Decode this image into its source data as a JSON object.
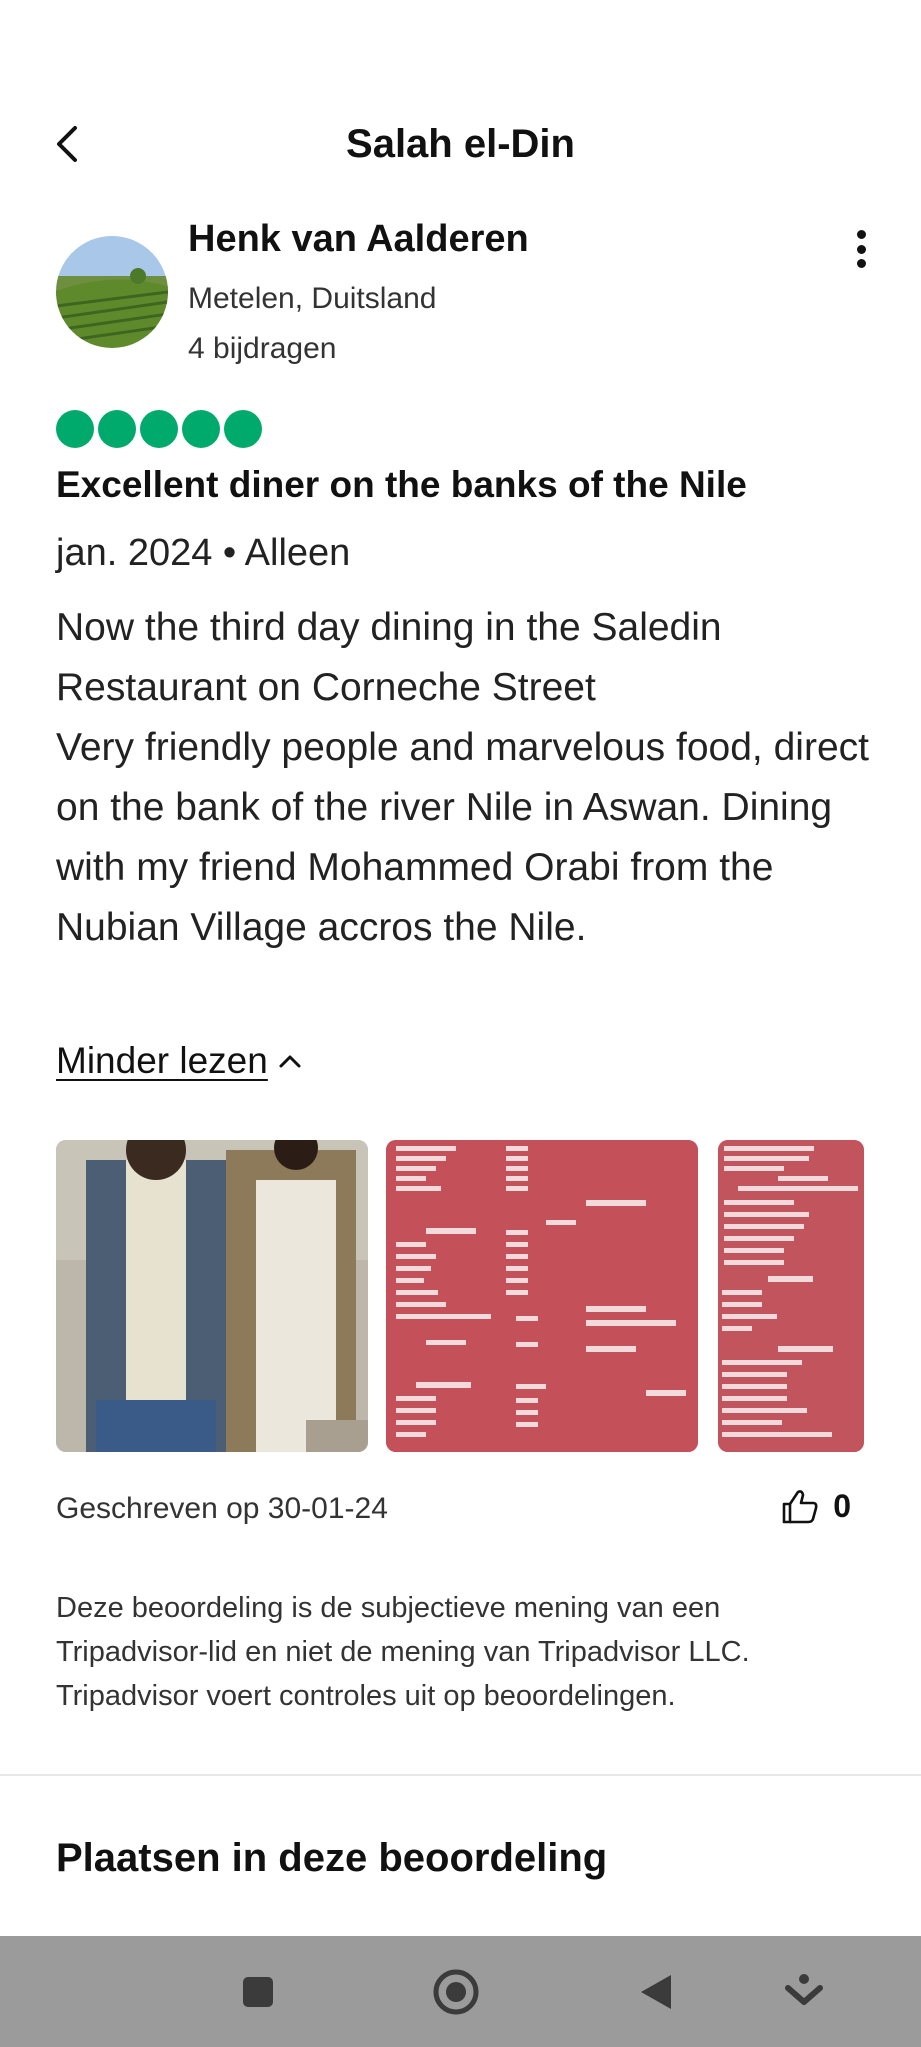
{
  "header": {
    "title": "Salah el-Din"
  },
  "reviewer": {
    "name": "Henk van Aalderen",
    "location": "Metelen, Duitsland",
    "contributions": "4 bijdragen"
  },
  "review": {
    "rating": 5,
    "title": "Excellent diner on the banks of the Nile",
    "meta": "jan. 2024 • Alleen",
    "body_lines": [
      "Now the third day dining in the Saledin Restaurant on Corneche Street",
      "Very friendly people and marvelous food, direct on the bank of the river Nile in Aswan. Dining with my friend Mohammed Orabi from the Nubian Village accros the Nile."
    ],
    "read_less": "Minder lezen",
    "written": "Geschreven op 30-01-24",
    "helpful_count": "0"
  },
  "photos": [
    "photo-two-men",
    "photo-menu-juices",
    "photo-menu-milkshakes"
  ],
  "disclaimer": "Deze beoordeling is de subjectieve mening van een Tripadvisor-lid en niet de mening van Tripadvisor LLC. Tripadvisor voert controles uit op beoordelingen.",
  "places": {
    "title": "Plaatsen in deze beoordeling"
  },
  "colors": {
    "rating_green": "#00aa6c",
    "navbar": "#9b9b9b",
    "menu_red": "#c4515a"
  }
}
